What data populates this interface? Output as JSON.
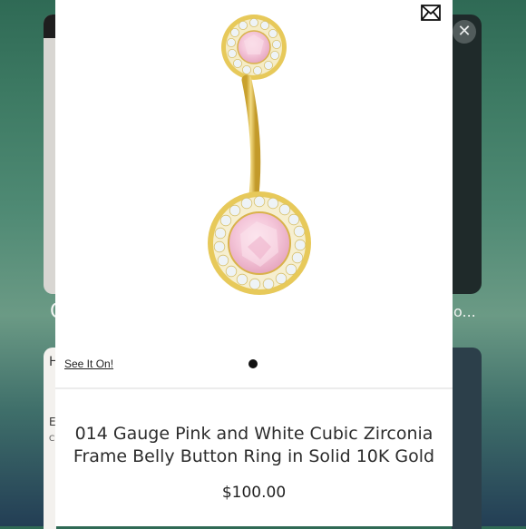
{
  "product": {
    "title": "014 Gauge Pink and White Cubic Zirconia Frame Belly Button Ring in Solid 10K Gold",
    "price": "$100.00",
    "try_on_link": "See It On!",
    "image_icon": "belly-button-ring-image"
  },
  "gallery": {
    "current_index": 1,
    "total": 1
  },
  "icons": {
    "share": "mail-icon",
    "close": "close-icon"
  },
  "background": {
    "close_glyph": "✕",
    "left_card_label": "C",
    "right_card_label": "o...",
    "left_card_fragment_1": "H",
    "left_card_fragment_2": "E",
    "left_card_fragment_3": "C"
  },
  "colors": {
    "gold": "#e3c24b",
    "pink_stone": "#f1c2d6",
    "white_stone": "#eef3f6",
    "sheet": "#ffffff"
  }
}
